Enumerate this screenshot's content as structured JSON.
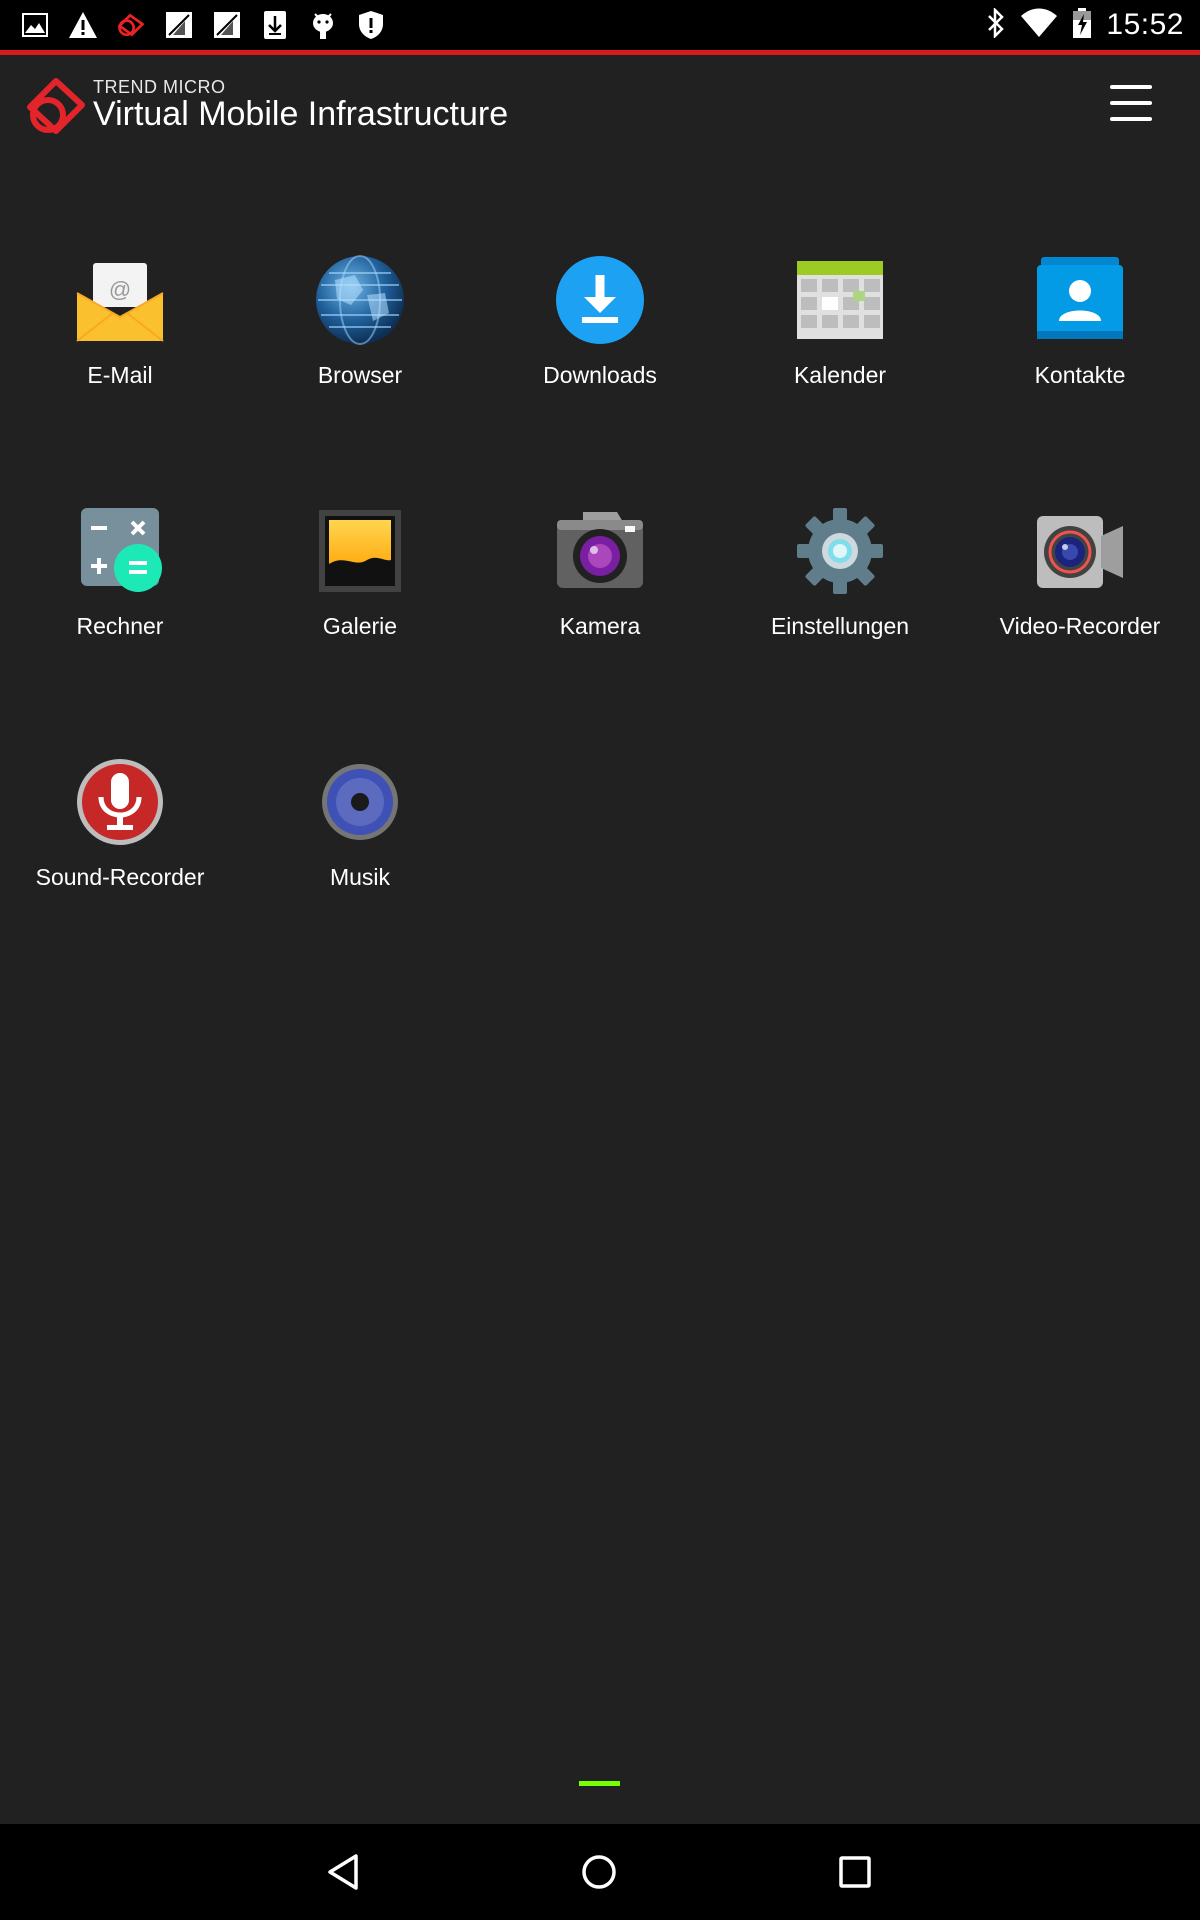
{
  "status_bar": {
    "time": "15:52",
    "notification_icons": [
      "gallery-icon",
      "warning-icon",
      "trend-micro-icon",
      "no-signal-icon",
      "no-signal-icon",
      "download-icon",
      "android-debug-icon",
      "shield-icon"
    ],
    "system_icons": [
      "bluetooth-icon",
      "wifi-icon",
      "battery-charging-icon"
    ]
  },
  "header": {
    "brand_small": "TREND MICRO",
    "title": "Virtual Mobile Infrastructure",
    "accent_color": "#d71920"
  },
  "apps": [
    {
      "label": "E-Mail",
      "icon": "email-icon"
    },
    {
      "label": "Browser",
      "icon": "browser-globe-icon"
    },
    {
      "label": "Downloads",
      "icon": "downloads-icon"
    },
    {
      "label": "Kalender",
      "icon": "calendar-icon"
    },
    {
      "label": "Kontakte",
      "icon": "contacts-icon"
    },
    {
      "label": "Rechner",
      "icon": "calculator-icon"
    },
    {
      "label": "Galerie",
      "icon": "gallery-icon"
    },
    {
      "label": "Kamera",
      "icon": "camera-icon"
    },
    {
      "label": "Einstellungen",
      "icon": "settings-gear-icon"
    },
    {
      "label": "Video-Recorder",
      "icon": "video-camera-icon"
    },
    {
      "label": "Sound-Recorder",
      "icon": "microphone-icon"
    },
    {
      "label": "Musik",
      "icon": "speaker-icon"
    }
  ],
  "page_indicator_color": "#76ff03",
  "nav_bar": [
    "back-icon",
    "home-icon",
    "recents-icon"
  ]
}
